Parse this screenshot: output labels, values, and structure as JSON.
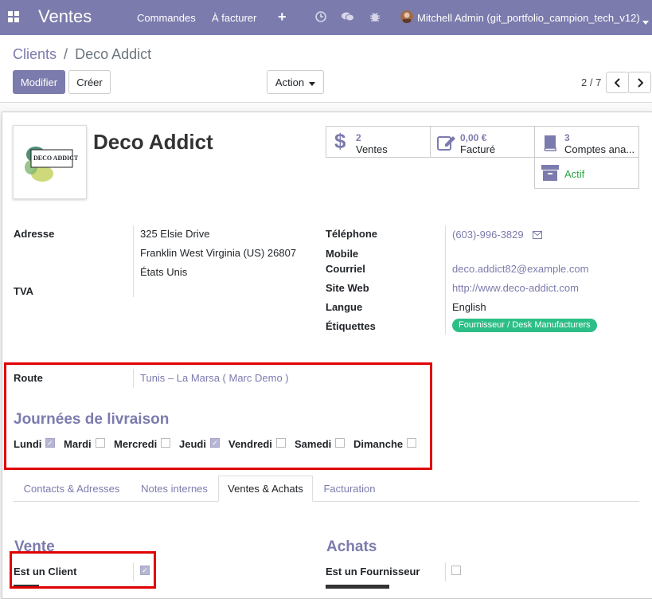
{
  "nav": {
    "app_title": "Ventes",
    "menu": [
      "Commandes",
      "À facturer"
    ],
    "user": "Mitchell Admin (git_portfolio_campion_tech_v12)"
  },
  "breadcrumb": {
    "parent": "Clients",
    "sep": "/",
    "current": "Deco Addict"
  },
  "toolbar": {
    "edit": "Modifier",
    "create": "Créer",
    "action": "Action",
    "pager": "2 / 7"
  },
  "partner": {
    "name": "Deco Addict",
    "logo_text": "DECO ADDICT",
    "stats": {
      "sales": {
        "count": "2",
        "label": "Ventes"
      },
      "invoiced": {
        "amount": "0,00 €",
        "label": "Facturé"
      },
      "analytic": {
        "count": "3",
        "label": "Comptes ana..."
      },
      "active": {
        "label": "Actif"
      }
    }
  },
  "address": {
    "label": "Adresse",
    "line1": "325 Elsie Drive",
    "line2": "Franklin West Virginia (US) 26807",
    "country": "États Unis",
    "vat_label": "TVA"
  },
  "contact": {
    "phone_label": "Téléphone",
    "phone": "(603)-996-3829",
    "mobile_label": "Mobile",
    "email_label": "Courriel",
    "email": "deco.addict82@example.com",
    "website_label": "Site Web",
    "website": "http://www.deco-addict.com",
    "lang_label": "Langue",
    "lang": "English",
    "tags_label": "Étiquettes",
    "tag": "Fournisseur / Desk Manufacturers"
  },
  "route": {
    "label": "Route",
    "value": "Tunis – La Marsa ( Marc Demo )"
  },
  "delivery": {
    "title": "Journées de livraison",
    "days": [
      {
        "label": "Lundi",
        "checked": true
      },
      {
        "label": "Mardi",
        "checked": false
      },
      {
        "label": "Mercredi",
        "checked": false
      },
      {
        "label": "Jeudi",
        "checked": true
      },
      {
        "label": "Vendredi",
        "checked": false
      },
      {
        "label": "Samedi",
        "checked": false
      },
      {
        "label": "Dimanche",
        "checked": false
      }
    ]
  },
  "tabs": [
    "Contacts & Adresses",
    "Notes internes",
    "Ventes & Achats",
    "Facturation"
  ],
  "sales_section": {
    "title": "Vente",
    "is_customer_label": "Est un Client"
  },
  "purchase_section": {
    "title": "Achats",
    "is_vendor_label": "Est un Fournisseur"
  },
  "colors": {
    "brand": "#7c7bad",
    "active": "#28a745",
    "tag": "#2cbe86",
    "highlight": "#e00000"
  }
}
